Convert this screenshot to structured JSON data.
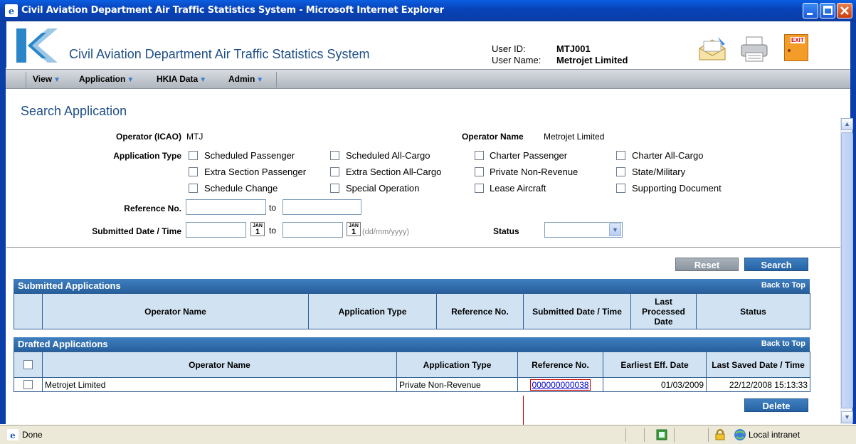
{
  "window": {
    "title": "Civil Aviation Department Air Traffic Statistics System - Microsoft Internet Explorer"
  },
  "header": {
    "app_title": "Civil Aviation Department Air Traffic Statistics System",
    "user_id_label": "User ID:",
    "user_id": "MTJ001",
    "user_name_label": "User Name:",
    "user_name": "Metrojet Limited",
    "exit_label": "EXIT"
  },
  "menu": {
    "items": [
      "View",
      "Application",
      "HKIA Data",
      "Admin"
    ]
  },
  "search": {
    "page_title": "Search Application",
    "operator_icao_label": "Operator (ICAO)",
    "operator_icao": "MTJ",
    "operator_name_label": "Operator Name",
    "operator_name": "Metrojet Limited",
    "application_type_label": "Application Type",
    "types": [
      "Scheduled Passenger",
      "Scheduled All-Cargo",
      "Charter Passenger",
      "Charter All-Cargo",
      "Extra Section Passenger",
      "Extra Section All-Cargo",
      "Private Non-Revenue",
      "State/Military",
      "Schedule Change",
      "Special Operation",
      "Lease Aircraft",
      "Supporting Document"
    ],
    "reference_no_label": "Reference No.",
    "to": "to",
    "submitted_label": "Submitted Date / Time",
    "cal_month": "JAN",
    "cal_day": "1",
    "date_hint": "(dd/mm/yyyy)",
    "status_label": "Status",
    "reset": "Reset",
    "search": "Search"
  },
  "submitted": {
    "title": "Submitted Applications",
    "back": "Back to Top",
    "columns": [
      "Operator Name",
      "Application Type",
      "Reference No.",
      "Submitted Date / Time",
      "Last Processed Date",
      "Status"
    ]
  },
  "drafted": {
    "title": "Drafted Applications",
    "back": "Back to Top",
    "columns": [
      "Operator Name",
      "Application Type",
      "Reference No.",
      "Earliest Eff. Date",
      "Last Saved Date / Time"
    ],
    "rows": [
      {
        "operator": "Metrojet Limited",
        "type": "Private Non-Revenue",
        "ref": "000000000038",
        "eff": "01/03/2009",
        "saved": "22/12/2008 15:13:33"
      }
    ],
    "delete": "Delete"
  },
  "status_bar": {
    "left": "Done",
    "zone": "Local intranet"
  }
}
